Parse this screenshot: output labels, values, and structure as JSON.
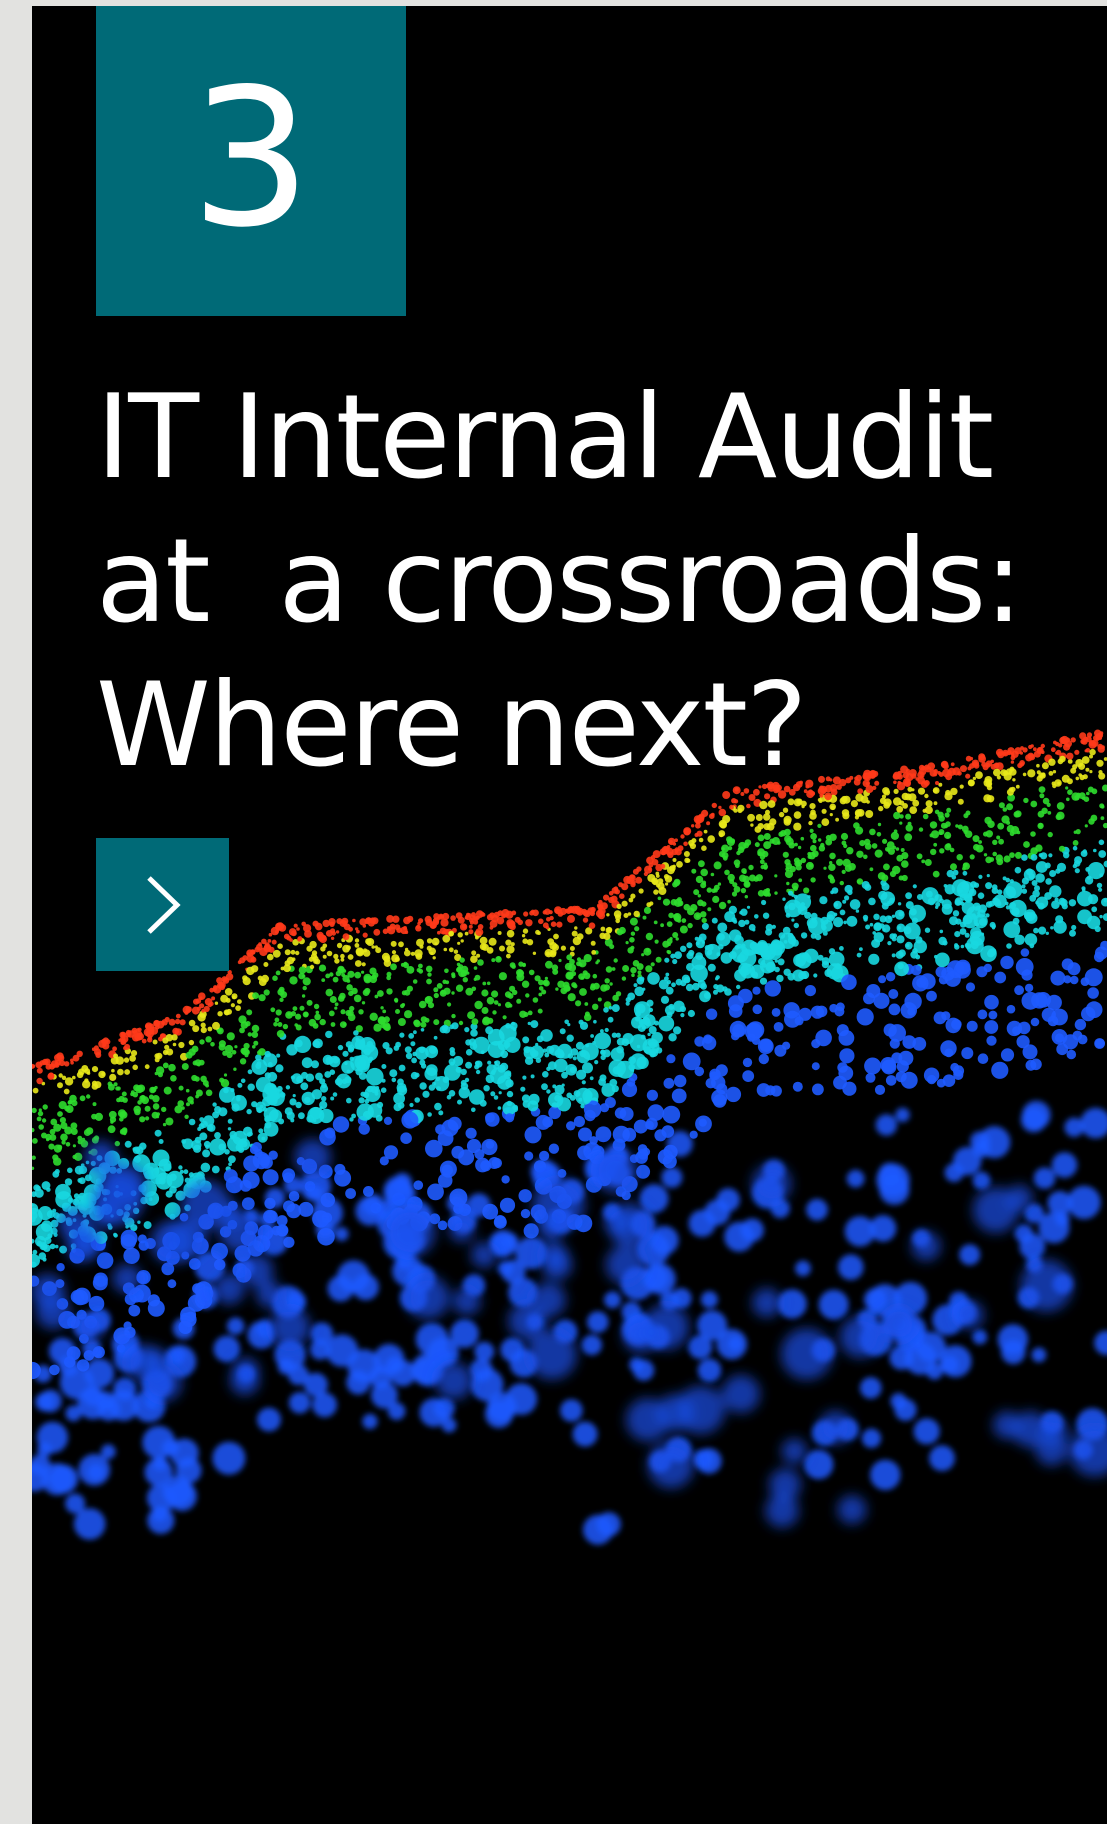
{
  "card": {
    "number": "3",
    "title": "IT Internal Audit\nat  a crossroads:\nWhere next?",
    "accent_color": "#006a77",
    "background_color": "#000000"
  },
  "next_button": {
    "icon": "chevron-right-icon"
  },
  "background_image": {
    "subject": "colorful point-cloud terrain",
    "colors": [
      "#ff3a1a",
      "#e8e81a",
      "#2edc2e",
      "#18d8e0",
      "#1f5bff"
    ]
  }
}
